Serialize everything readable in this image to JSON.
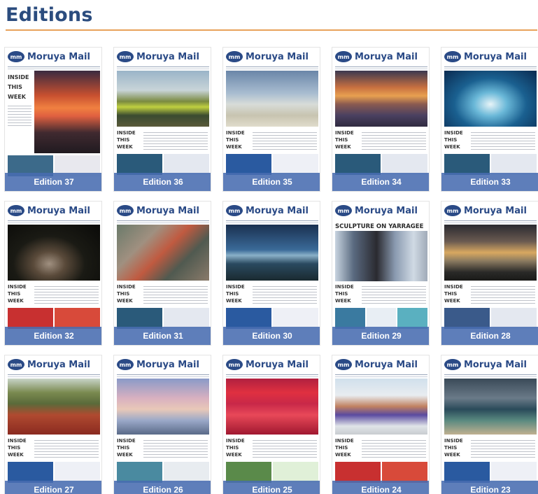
{
  "heading": "Editions",
  "masthead": "Moruya Mail",
  "badge": "mm",
  "inside_label": [
    "INSIDE",
    "THIS",
    "WEEK"
  ],
  "headline_29": "SCULPTURE ON YARRAGEE",
  "editions": [
    {
      "label": "Edition 37"
    },
    {
      "label": "Edition 36"
    },
    {
      "label": "Edition 35"
    },
    {
      "label": "Edition 34"
    },
    {
      "label": "Edition 33"
    },
    {
      "label": "Edition 32"
    },
    {
      "label": "Edition 31"
    },
    {
      "label": "Edition 30"
    },
    {
      "label": "Edition 29"
    },
    {
      "label": "Edition 28"
    },
    {
      "label": "Edition 27"
    },
    {
      "label": "Edition 26"
    },
    {
      "label": "Edition 25"
    },
    {
      "label": "Edition 24"
    },
    {
      "label": "Edition 23"
    }
  ]
}
